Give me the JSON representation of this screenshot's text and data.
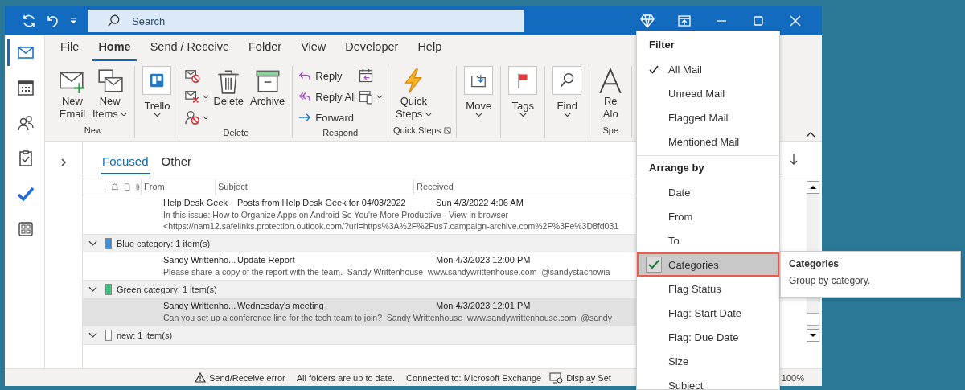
{
  "title_bar": {
    "search_placeholder": "Search"
  },
  "nav_rail": [
    {
      "kind": "mail",
      "selected": true
    },
    {
      "kind": "calendar",
      "selected": false
    },
    {
      "kind": "people",
      "selected": false
    },
    {
      "kind": "tasks",
      "selected": false
    },
    {
      "kind": "todo",
      "selected": false
    },
    {
      "kind": "apps",
      "selected": false
    }
  ],
  "ribbon_tabs": [
    {
      "label": "File",
      "selected": false
    },
    {
      "label": "Home",
      "selected": true
    },
    {
      "label": "Send / Receive",
      "selected": false
    },
    {
      "label": "Folder",
      "selected": false
    },
    {
      "label": "View",
      "selected": false
    },
    {
      "label": "Developer",
      "selected": false
    },
    {
      "label": "Help",
      "selected": false
    }
  ],
  "ribbon_groups": [
    {
      "label": "New",
      "controls": [
        {
          "kind": "large",
          "lines": [
            "New",
            "Email"
          ],
          "dropdown": false
        },
        {
          "kind": "large",
          "lines": [
            "New",
            "Items"
          ],
          "dropdown": true
        }
      ]
    },
    {
      "controls": [
        {
          "kind": "boxed",
          "lines": [
            "Trello"
          ],
          "dropdown": true
        }
      ]
    },
    {
      "label": "Delete",
      "controls": [
        {
          "kind": "icon-stack",
          "buttons": [
            {
              "dropdown": false
            },
            {
              "dropdown": true
            },
            {
              "dropdown": true
            }
          ]
        },
        {
          "kind": "large",
          "lines": [
            "Delete"
          ],
          "dropdown": false
        },
        {
          "kind": "large",
          "lines": [
            "Archive"
          ],
          "dropdown": false
        }
      ]
    },
    {
      "label": "Respond",
      "controls": [
        {
          "kind": "text-stack",
          "buttons": [
            {
              "label": "Reply"
            },
            {
              "label": "Reply All"
            },
            {
              "label": "Forward"
            }
          ]
        },
        {
          "kind": "icon-stack",
          "buttons": [
            {
              "dropdown": false
            },
            {
              "dropdown": true
            }
          ]
        }
      ]
    },
    {
      "label": "Quick Steps",
      "launcher": true,
      "controls": [
        {
          "kind": "large",
          "lines": [
            "Quick",
            "Steps"
          ],
          "dropdown": true
        }
      ]
    },
    {
      "controls": [
        {
          "kind": "boxed",
          "lines": [
            "Move"
          ],
          "dropdown": true
        }
      ]
    },
    {
      "controls": [
        {
          "kind": "boxed",
          "lines": [
            "Tags"
          ],
          "dropdown": true
        }
      ]
    },
    {
      "controls": [
        {
          "kind": "boxed",
          "lines": [
            "Find"
          ],
          "dropdown": true
        }
      ]
    },
    {
      "label": "Spe",
      "controls": [
        {
          "kind": "large",
          "lines": [
            "Re",
            "Alo"
          ],
          "dropdown": false
        }
      ]
    }
  ],
  "message_list": {
    "tabs": [
      {
        "label": "Focused",
        "selected": true
      },
      {
        "label": "Other",
        "selected": false
      }
    ],
    "columns": [
      "From",
      "Subject",
      "Received"
    ],
    "rows": [
      {
        "kind": "message",
        "from": "Help Desk Geek",
        "subject": "Posts from Help Desk Geek for 04/03/2022",
        "received": "Sun 4/3/2022 4:06 AM",
        "preview": [
          "In this issue: How to Organize Apps on Android So You're More Productive - View in browser",
          "<https://nam12.safelinks.protection.outlook.com/?url=https%3A%2F%2Fus7.campaign-archive.com%2F%3Fe%3D8fd031"
        ],
        "selected": false
      },
      {
        "kind": "group",
        "label": "Blue category: 1 item(s)",
        "color": "#3d8fdc",
        "expanded": true
      },
      {
        "kind": "message",
        "from": "Sandy Writtenho...",
        "subject": "Update Report",
        "received": "Mon 4/3/2023 12:00 PM",
        "preview": [
          "Please share a copy of the report with the team.  Sandy Writtenhouse  www.sandywrittenhouse.com  @sandystachowia"
        ],
        "selected": false
      },
      {
        "kind": "group",
        "label": "Green category: 1 item(s)",
        "color": "#3cc47c",
        "expanded": true
      },
      {
        "kind": "message",
        "from": "Sandy Writtenho...",
        "subject": "Wednesday's meeting",
        "received": "Mon 4/3/2023 12:01 PM",
        "preview": [
          "Can you set up a conference line for the tech team to join?  Sandy Writtenhouse  www.sandywrittenhouse.com  @sandy"
        ],
        "selected": true
      },
      {
        "kind": "group",
        "label": "new: 1 item(s)",
        "color": "#ffffff",
        "expanded": true
      }
    ]
  },
  "status_bar": [
    {
      "kind": "warning",
      "text": "Send/Receive error"
    },
    {
      "kind": "plain",
      "text": "All folders are up to date."
    },
    {
      "kind": "plain",
      "text": "Connected to: Microsoft Exchange"
    },
    {
      "kind": "display",
      "text": "Display Set"
    },
    {
      "kind": "zoom",
      "text": "100%"
    }
  ],
  "menu": [
    {
      "heading": "Filter",
      "items": [
        {
          "label": "All Mail",
          "checked": true,
          "highlighted": false
        },
        {
          "label": "Unread Mail",
          "checked": false,
          "highlighted": false
        },
        {
          "label": "Flagged Mail",
          "checked": false,
          "highlighted": false
        },
        {
          "label": "Mentioned Mail",
          "checked": false,
          "highlighted": false
        }
      ]
    },
    {
      "heading": "Arrange by",
      "items": [
        {
          "label": "Date",
          "checked": false,
          "highlighted": false
        },
        {
          "label": "From",
          "checked": false,
          "highlighted": false
        },
        {
          "label": "To",
          "checked": false,
          "highlighted": false
        },
        {
          "label": "Categories",
          "checked": true,
          "highlighted": true
        },
        {
          "label": "Flag Status",
          "checked": false,
          "highlighted": false
        },
        {
          "label": "Flag: Start Date",
          "checked": false,
          "highlighted": false
        },
        {
          "label": "Flag: Due Date",
          "checked": false,
          "highlighted": false
        },
        {
          "label": "Size",
          "checked": false,
          "highlighted": false
        },
        {
          "label": "Subject",
          "checked": false,
          "highlighted": false
        }
      ]
    }
  ],
  "tooltip": {
    "title": "Categories",
    "text": "Group by category."
  }
}
